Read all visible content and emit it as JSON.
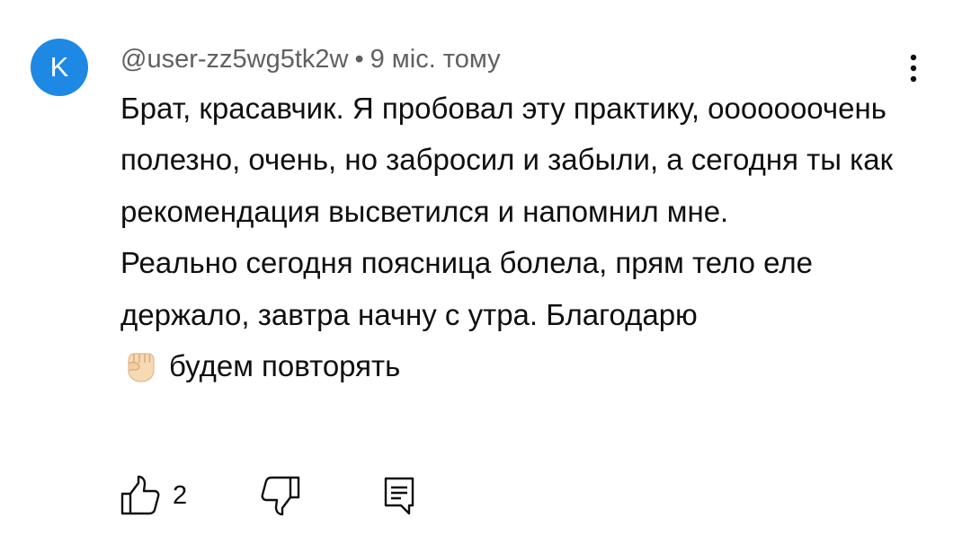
{
  "comment": {
    "avatar_letter": "K",
    "avatar_color": "#1e88e5",
    "username": "@user-zz5wg5tk2w",
    "separator": "•",
    "timestamp": "9 міс. тому",
    "paragraphs": [
      "Брат, красавчик. Я пробовал эту практику, ооооооочень полезно, очень, но забросил и забыли, а сегодня ты как рекомендация высветился и напомнил мне.",
      "Реально сегодня поясница болела, прям тело еле держало, завтра начну с утра. Благодарю"
    ],
    "emoji_icon": "raised-fist-emoji-icon",
    "closing_text": "будем повторять"
  },
  "actions": {
    "like_icon": "thumbs-up-icon",
    "like_count": "2",
    "dislike_icon": "thumbs-down-icon",
    "reply_icon": "reply-comment-icon",
    "menu_icon": "more-vertical-icon"
  }
}
